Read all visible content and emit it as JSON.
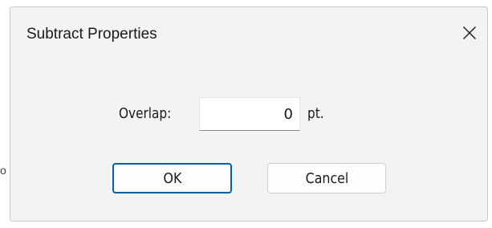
{
  "background_fragment": "o",
  "dialog": {
    "title": "Subtract Properties",
    "close_icon": "close-icon",
    "overlap": {
      "label": "Overlap:",
      "value": "0",
      "unit": "pt."
    },
    "buttons": {
      "ok_label": "OK",
      "cancel_label": "Cancel"
    },
    "colors": {
      "accent": "#005fb8",
      "dialog_background": "#f3f3f3"
    }
  }
}
